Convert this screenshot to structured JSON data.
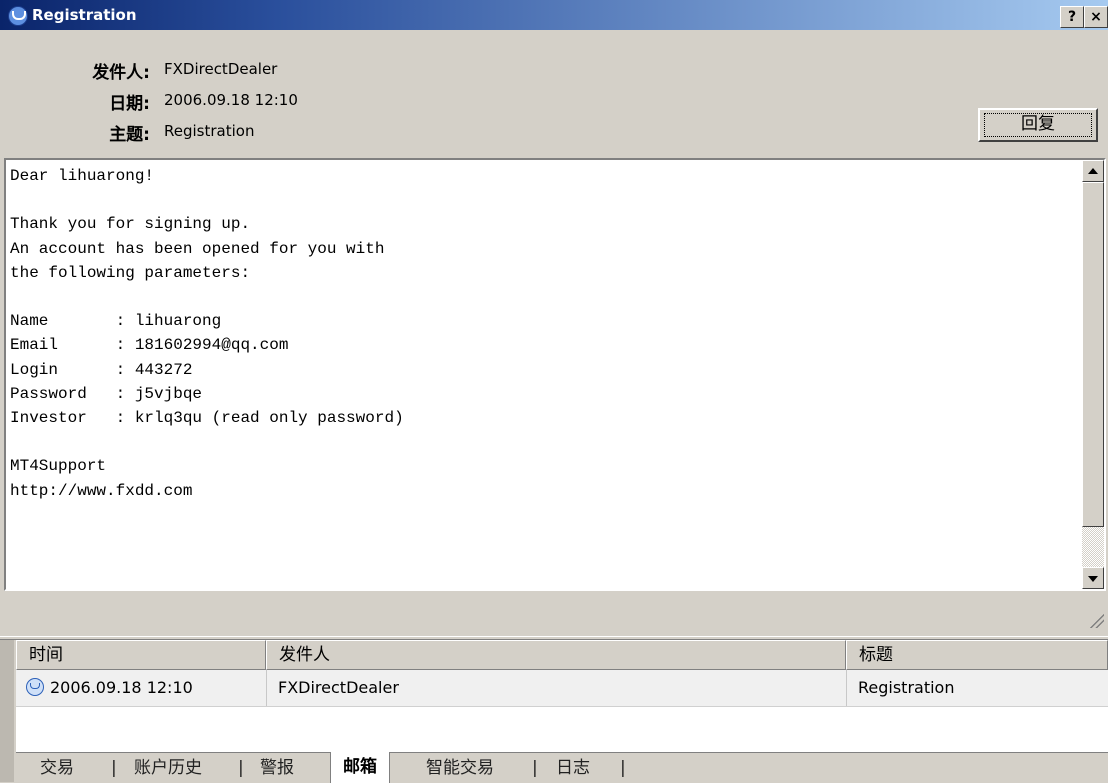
{
  "window": {
    "title": "Registration",
    "help_glyph": "?",
    "close_glyph": "×"
  },
  "header": {
    "from_label": "发件人:",
    "from_value": "FXDirectDealer",
    "date_label": "日期:",
    "date_value": "2006.09.18 12:10",
    "subject_label": "主题:",
    "subject_value": "Registration"
  },
  "reply_label": "回复",
  "message_lines": [
    "Dear lihuarong!",
    "",
    "Thank you for signing up.",
    "An account has been opened for you with",
    "the following parameters:",
    "",
    "Name       : lihuarong",
    "Email      : 181602994@qq.com",
    "Login      : 443272",
    "Password   : j5vjbqe",
    "Investor   : krlq3qu (read only password)",
    "",
    "MT4Support",
    "http://www.fxdd.com"
  ],
  "mailbox": {
    "columns": [
      "时间",
      "发件人",
      "标题"
    ],
    "rows": [
      {
        "time": "2006.09.18 12:10",
        "from": "FXDirectDealer",
        "subject": "Registration"
      }
    ]
  },
  "tabs": [
    {
      "label": "交易",
      "active": false
    },
    {
      "label": "账户历史",
      "active": false
    },
    {
      "label": "警报",
      "active": false
    },
    {
      "label": "邮箱",
      "active": true
    },
    {
      "label": "智能交易",
      "active": false
    },
    {
      "label": "日志",
      "active": false
    }
  ],
  "tab_separator": "|",
  "icons": {
    "window_icon": "mail-icon",
    "row_icon": "envelope-icon"
  },
  "colors": {
    "title_bar": "#0a246a",
    "face": "#d4d0c8"
  }
}
